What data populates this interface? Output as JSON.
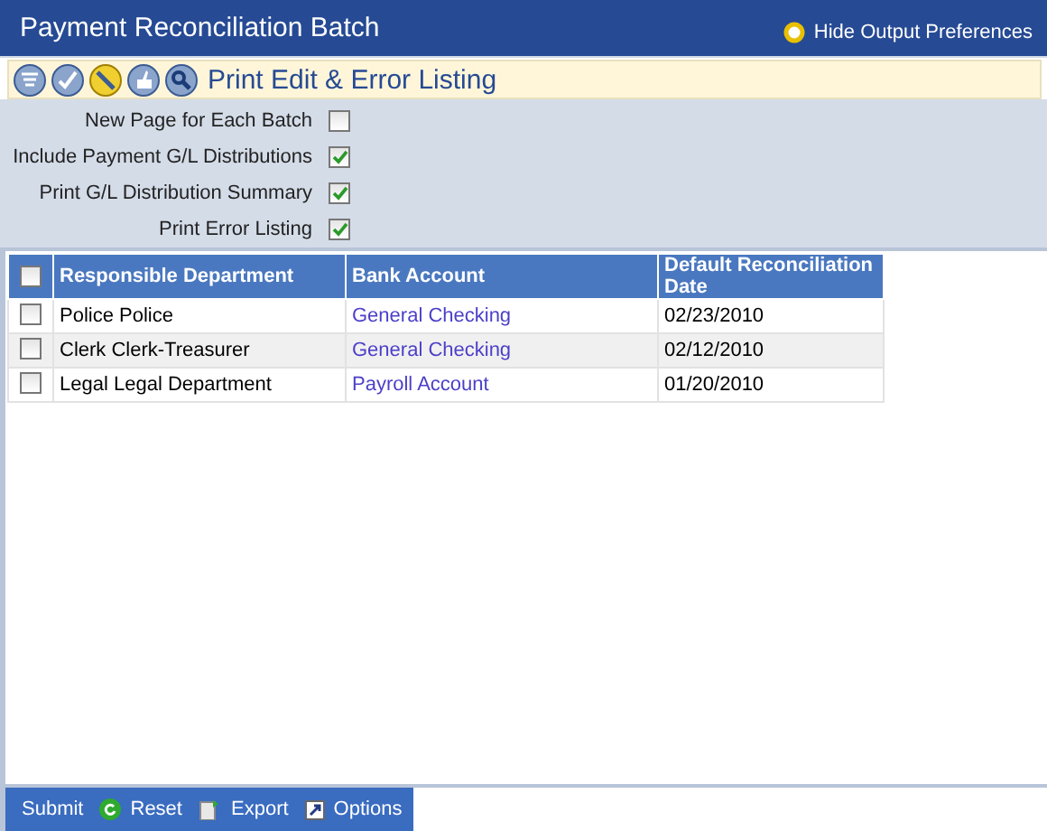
{
  "window": {
    "title": "Payment Reconciliation Batch",
    "header_link": "Hide Output Preferences"
  },
  "report": {
    "title": "Print Edit & Error Listing"
  },
  "options": [
    {
      "label": "New Page for Each Batch",
      "checked": false
    },
    {
      "label": "Include Payment G/L Distributions",
      "checked": true
    },
    {
      "label": "Print G/L Distribution Summary",
      "checked": true
    },
    {
      "label": "Print Error Listing",
      "checked": true
    }
  ],
  "table": {
    "select_all_checked": false,
    "columns": [
      "Responsible Department",
      "Bank Account",
      "Default Reconciliation Date"
    ],
    "rows": [
      {
        "checked": false,
        "cells": [
          "Police Police",
          "General Checking",
          "02/23/2010"
        ]
      },
      {
        "checked": false,
        "cells": [
          "Clerk Clerk-Treasurer",
          "General Checking",
          "02/12/2010"
        ]
      },
      {
        "checked": false,
        "cells": [
          "Legal Legal Department",
          "Payroll Account",
          "01/20/2010"
        ]
      }
    ]
  },
  "footer": [
    {
      "kind": "plain",
      "label": "Submit"
    },
    {
      "kind": "reset",
      "label": "Reset"
    },
    {
      "kind": "export",
      "label": "Export"
    },
    {
      "kind": "options",
      "label": "Options"
    }
  ]
}
